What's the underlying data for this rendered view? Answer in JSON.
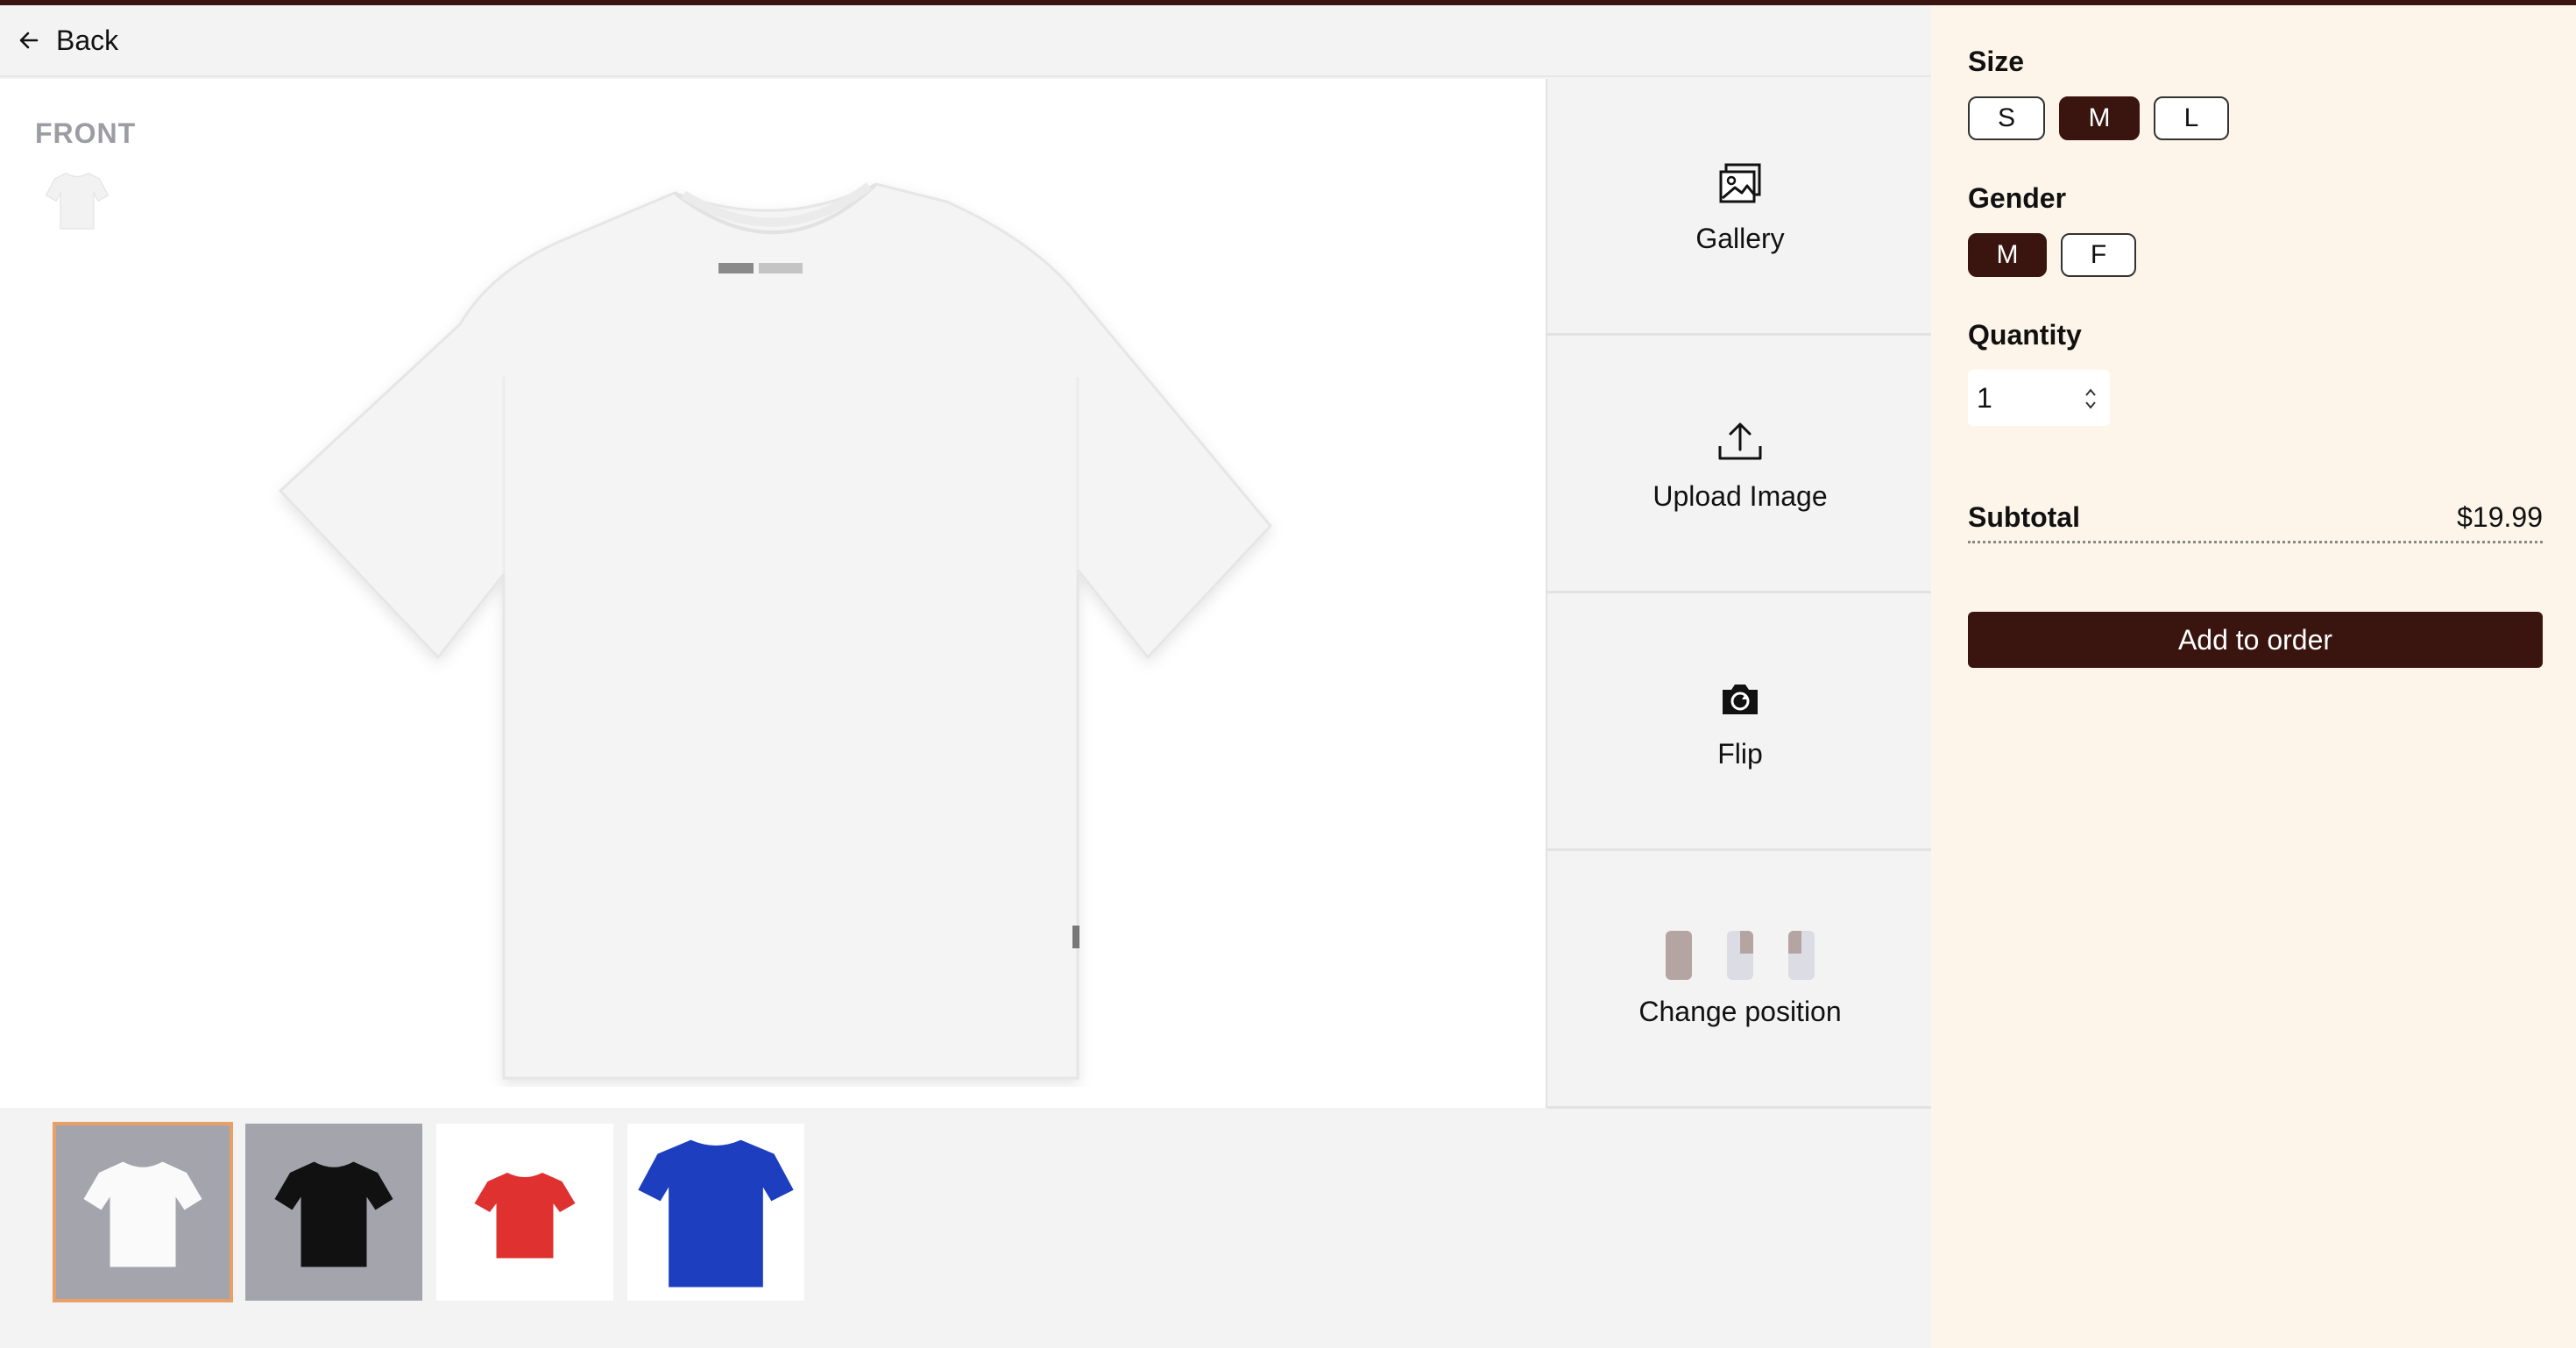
{
  "header": {
    "back_label": "Back"
  },
  "canvas": {
    "view_label": "FRONT"
  },
  "tools": [
    {
      "label": "Gallery",
      "icon": "gallery-icon"
    },
    {
      "label": "Upload Image",
      "icon": "upload-icon"
    },
    {
      "label": "Flip",
      "icon": "flip-camera-icon"
    },
    {
      "label": "Change position",
      "icon": "position-icons"
    }
  ],
  "variants": [
    {
      "color": "white",
      "hex": "#ffffff",
      "selected": true
    },
    {
      "color": "black",
      "hex": "#111111",
      "selected": false
    },
    {
      "color": "red",
      "hex": "#e03131",
      "selected": false
    },
    {
      "color": "blue",
      "hex": "#1d3fbf",
      "selected": false
    }
  ],
  "order": {
    "size_label": "Size",
    "sizes": [
      "S",
      "M",
      "L"
    ],
    "size_selected": "M",
    "gender_label": "Gender",
    "genders": [
      "M",
      "F"
    ],
    "gender_selected": "M",
    "quantity_label": "Quantity",
    "quantity_value": "1",
    "subtotal_label": "Subtotal",
    "subtotal_value": "$19.99",
    "add_button": "Add to order"
  },
  "colors": {
    "accent": "#3a1510",
    "panel_bg": "#fdf5ea",
    "selected_outline": "#e8a067"
  }
}
